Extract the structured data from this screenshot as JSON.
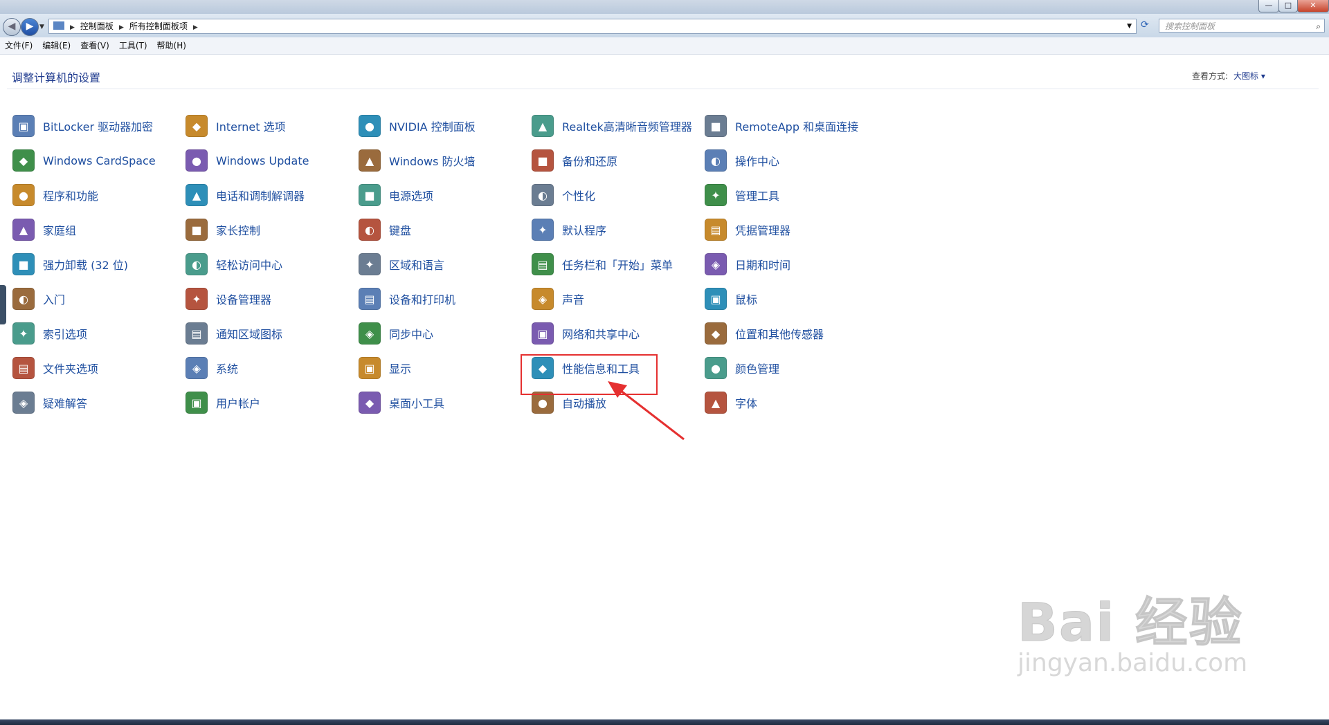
{
  "window": {
    "minimize": "—",
    "maximize": "□",
    "close": "✕"
  },
  "address": {
    "crumbs": [
      "控制面板",
      "所有控制面板项"
    ],
    "search_placeholder": "搜索控制面板"
  },
  "menu": [
    "文件(F)",
    "编辑(E)",
    "查看(V)",
    "工具(T)",
    "帮助(H)"
  ],
  "header": {
    "title": "调整计算机的设置",
    "view_label": "查看方式:",
    "view_value": "大图标 ▾"
  },
  "items": [
    [
      "BitLocker 驱动器加密",
      "Windows CardSpace",
      "程序和功能",
      "家庭组",
      "强力卸载 (32 位)",
      "入门",
      "索引选项",
      "文件夹选项",
      "疑难解答"
    ],
    [
      "Internet 选项",
      "Windows Update",
      "电话和调制解调器",
      "家长控制",
      "轻松访问中心",
      "设备管理器",
      "通知区域图标",
      "系统",
      "用户帐户"
    ],
    [
      "NVIDIA 控制面板",
      "Windows 防火墙",
      "电源选项",
      "键盘",
      "区域和语言",
      "设备和打印机",
      "同步中心",
      "显示",
      "桌面小工具"
    ],
    [
      "Realtek高清晰音频管理器",
      "备份和还原",
      "个性化",
      "默认程序",
      "任务栏和「开始」菜单",
      "声音",
      "网络和共享中心",
      "性能信息和工具",
      "自动播放"
    ],
    [
      "RemoteApp 和桌面连接",
      "操作中心",
      "管理工具",
      "凭据管理器",
      "日期和时间",
      "鼠标",
      "位置和其他传感器",
      "颜色管理",
      "字体"
    ]
  ],
  "watermark": {
    "main": "Bai 经验",
    "url": "jingyan.baidu.com"
  }
}
